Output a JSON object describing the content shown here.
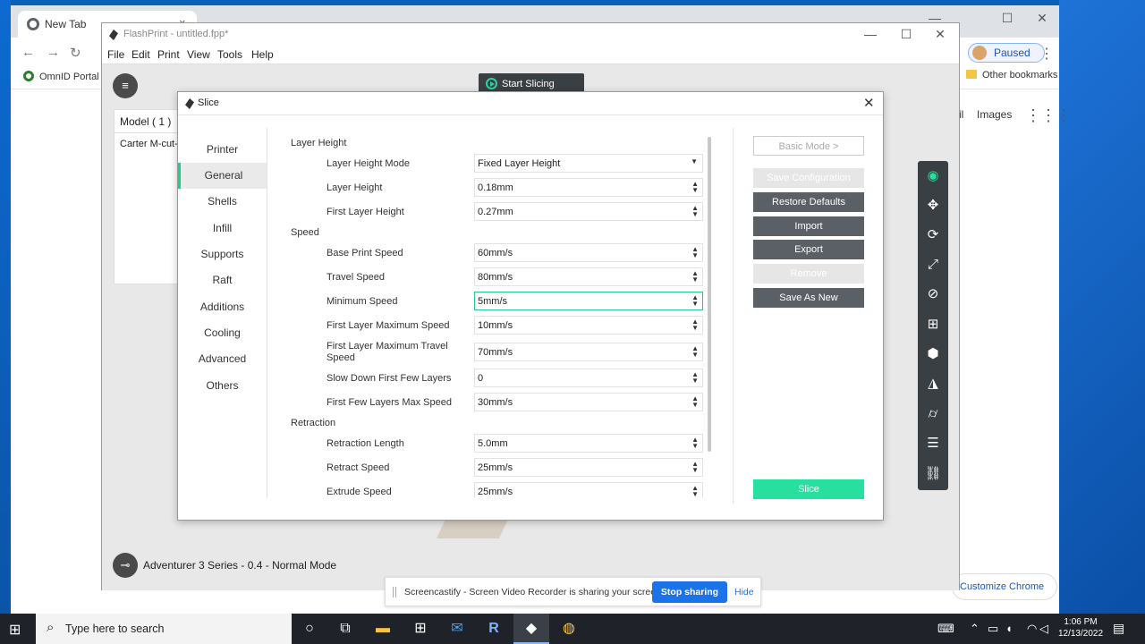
{
  "chrome": {
    "tab_title": "New Tab",
    "tab_close": "×",
    "paused_label": "Paused",
    "bookmark_omnid": "OmnID Portal",
    "other_bookmarks": "Other bookmarks",
    "gmail_partial": "il",
    "images": "Images",
    "customize": "Customize Chrome",
    "menu_dots": "⋮",
    "back": "←",
    "forward": "→",
    "reload": "↻",
    "minimize": "—",
    "maximize": "☐",
    "close": "✕"
  },
  "flashprint": {
    "title": "FlashPrint - untitled.fpp*",
    "menu": [
      "File",
      "Edit",
      "Print",
      "View",
      "Tools",
      "Help"
    ],
    "start_slicing": "Start Slicing",
    "model_header": "Model ( 1 )",
    "model_item": "Carter M-cut-",
    "status": "Adventurer 3 Series - 0.4 - Normal Mode",
    "minimize": "—",
    "maximize": "☐",
    "close": "✕"
  },
  "slice": {
    "title": "Slice",
    "close": "✕",
    "nav": [
      "Printer",
      "General",
      "Shells",
      "Infill",
      "Supports",
      "Raft",
      "Additions",
      "Cooling",
      "Advanced",
      "Others"
    ],
    "active_nav": "General",
    "sections": {
      "layer_height": "Layer Height",
      "speed": "Speed",
      "retraction": "Retraction"
    },
    "rows": [
      {
        "label": "Layer Height Mode",
        "value": "Fixed Layer Height"
      },
      {
        "label": "Layer Height",
        "value": "0.18mm"
      },
      {
        "label": "First Layer Height",
        "value": "0.27mm"
      },
      {
        "label": "Base Print Speed",
        "value": "60mm/s"
      },
      {
        "label": "Travel Speed",
        "value": "80mm/s"
      },
      {
        "label": "Minimum Speed",
        "value": "5mm/s"
      },
      {
        "label": "First Layer Maximum Speed",
        "value": "10mm/s"
      },
      {
        "label": "First Layer Maximum Travel Speed",
        "value": "70mm/s"
      },
      {
        "label": "Slow Down First Few Layers",
        "value": "0"
      },
      {
        "label": "First Few Layers Max Speed",
        "value": "30mm/s"
      },
      {
        "label": "Retraction Length",
        "value": "5.0mm"
      },
      {
        "label": "Retract Speed",
        "value": "25mm/s"
      },
      {
        "label": "Extrude Speed",
        "value": "25mm/s"
      }
    ],
    "buttons": {
      "basic_mode": "Basic Mode >",
      "save_config": "Save Configuration",
      "restore": "Restore Defaults",
      "import": "Import",
      "export": "Export",
      "remove": "Remove",
      "save_as_new": "Save As New",
      "slice": "Slice"
    }
  },
  "screencastify": {
    "message": "Screencastify - Screen Video Recorder is sharing your screen.",
    "stop": "Stop sharing",
    "hide": "Hide"
  },
  "taskbar": {
    "search_placeholder": "Type here to search",
    "time": "1:06 PM",
    "date": "12/13/2022"
  },
  "colors": {
    "accent_green": "#27e0a0",
    "dark_toolbar": "#3a3f44",
    "chrome_blue": "#1a73e8"
  }
}
